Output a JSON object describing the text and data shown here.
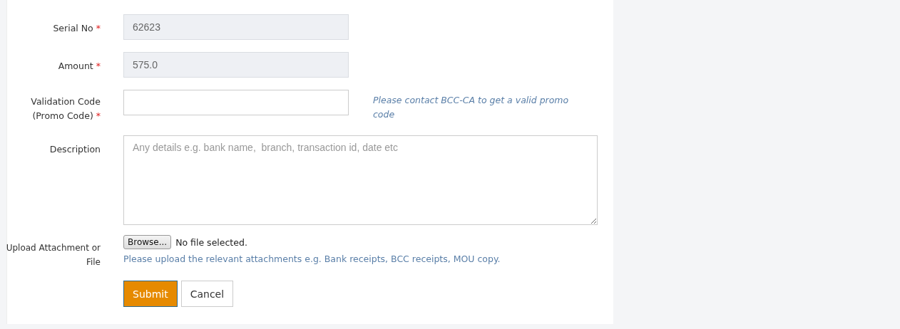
{
  "fields": [
    {
      "kind": "text",
      "label": "Serial No",
      "required_mark": "*",
      "value": "62623",
      "disabled": true
    },
    {
      "kind": "text",
      "label": "Amount",
      "required_mark": "*",
      "value": "575.0",
      "disabled": true
    },
    {
      "kind": "text",
      "label": "Validation Code (Promo Code)",
      "required_mark": "*",
      "disabled": false,
      "hint": "Please contact BCC-CA to get a valid promo code"
    },
    {
      "kind": "textarea",
      "label": "Description",
      "placeholder": "Any details e.g. bank name,  branch, transaction id, date etc"
    },
    {
      "kind": "file",
      "label": "Upload Attachment or File",
      "browse": "Browse...",
      "status": "No file selected.",
      "help": "Please upload the relevant attachments e.g. Bank receipts, BCC receipts, MOU copy."
    }
  ],
  "buttons": [
    {
      "kind": "primary",
      "label": "Submit"
    },
    {
      "kind": "default",
      "label": "Cancel"
    }
  ]
}
